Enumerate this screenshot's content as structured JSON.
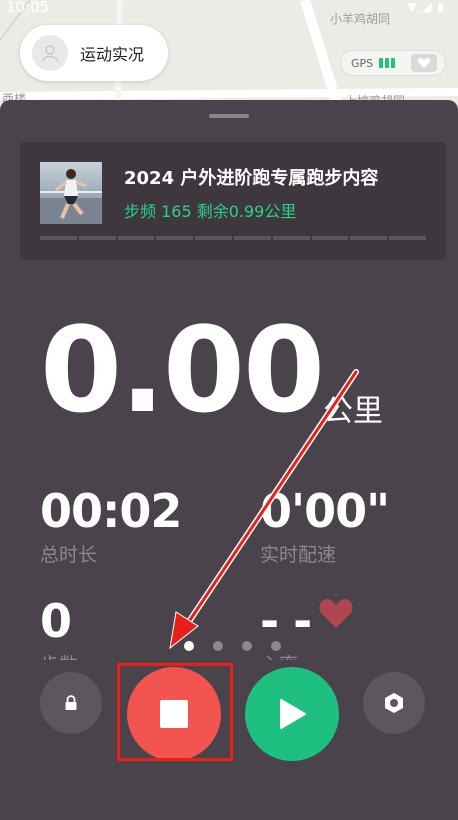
{
  "status_bar": {
    "time": "10:05"
  },
  "map": {
    "road_labels": [
      "小羊鸡胡同",
      "上坡鸡胡同",
      "西楼"
    ]
  },
  "header": {
    "back_label": "运动实况",
    "gps_label": "GPS"
  },
  "course": {
    "title": "2024 户外进阶跑专属跑步内容",
    "subtitle": "步频 165 剩余0.99公里",
    "segments": 10
  },
  "distance": {
    "value": "0.00",
    "unit": "公里"
  },
  "stats": {
    "duration": {
      "value": "00:02",
      "label": "总时长"
    },
    "pace": {
      "value": "0'00\"",
      "label": "实时配速"
    },
    "steps": {
      "value": "0",
      "label": "步数"
    },
    "heart_rate": {
      "value": "- -",
      "label": "心率"
    }
  },
  "pager": {
    "count": 4,
    "active_index": 0
  },
  "controls": {
    "lock_icon": "lock-icon",
    "stop_icon": "stop-icon",
    "resume_icon": "play-icon",
    "settings_icon": "hexagon-gear-icon"
  },
  "colors": {
    "panel": "#4b434b",
    "accent_green": "#2bd18a",
    "stop_red": "#f2554f",
    "resume_green": "#1fbf80",
    "annotation_red": "#e8201a"
  }
}
